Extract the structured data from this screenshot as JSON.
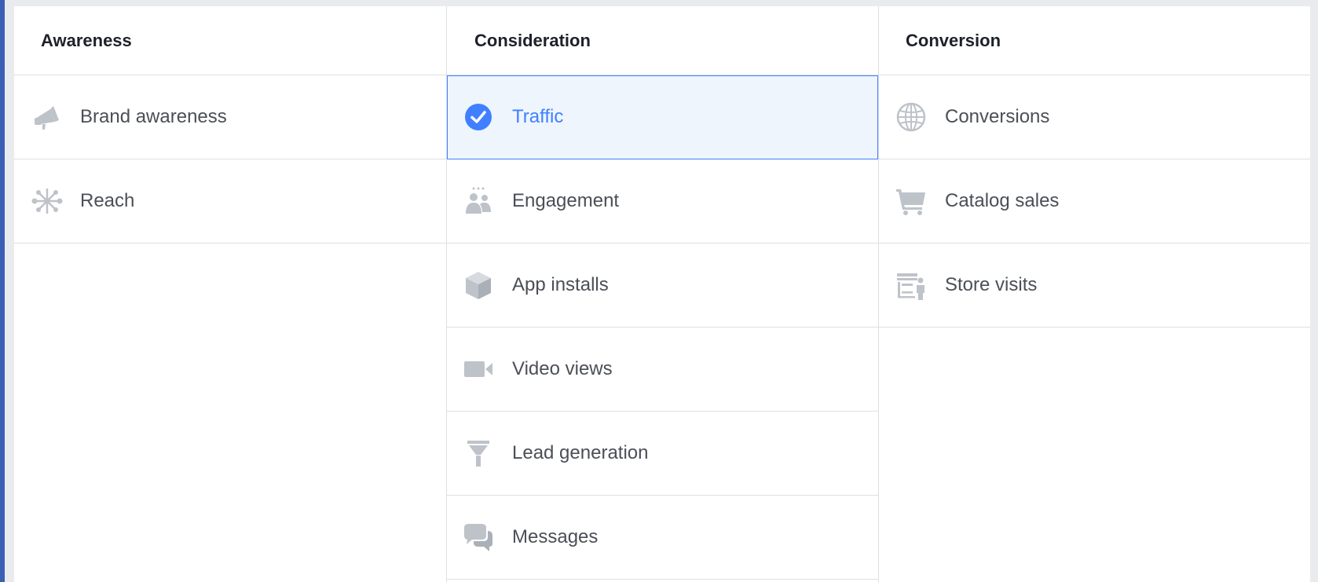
{
  "colors": {
    "accent": "#4080ff",
    "icon": "#bec3c9",
    "text": "#4b4f56",
    "header_text": "#1d2129",
    "border": "#dddfe2",
    "selected_bg": "#eef5fd"
  },
  "columns": [
    {
      "title": "Awareness",
      "items": [
        {
          "label": "Brand awareness",
          "icon": "megaphone-icon"
        },
        {
          "label": "Reach",
          "icon": "reach-icon"
        }
      ]
    },
    {
      "title": "Consideration",
      "items": [
        {
          "label": "Traffic",
          "icon": "check-circle-icon",
          "selected": true
        },
        {
          "label": "Engagement",
          "icon": "people-icon"
        },
        {
          "label": "App installs",
          "icon": "cube-icon"
        },
        {
          "label": "Video views",
          "icon": "video-camera-icon"
        },
        {
          "label": "Lead generation",
          "icon": "funnel-icon"
        },
        {
          "label": "Messages",
          "icon": "chat-bubbles-icon"
        }
      ]
    },
    {
      "title": "Conversion",
      "items": [
        {
          "label": "Conversions",
          "icon": "globe-icon"
        },
        {
          "label": "Catalog sales",
          "icon": "cart-icon"
        },
        {
          "label": "Store visits",
          "icon": "store-icon"
        }
      ]
    }
  ]
}
